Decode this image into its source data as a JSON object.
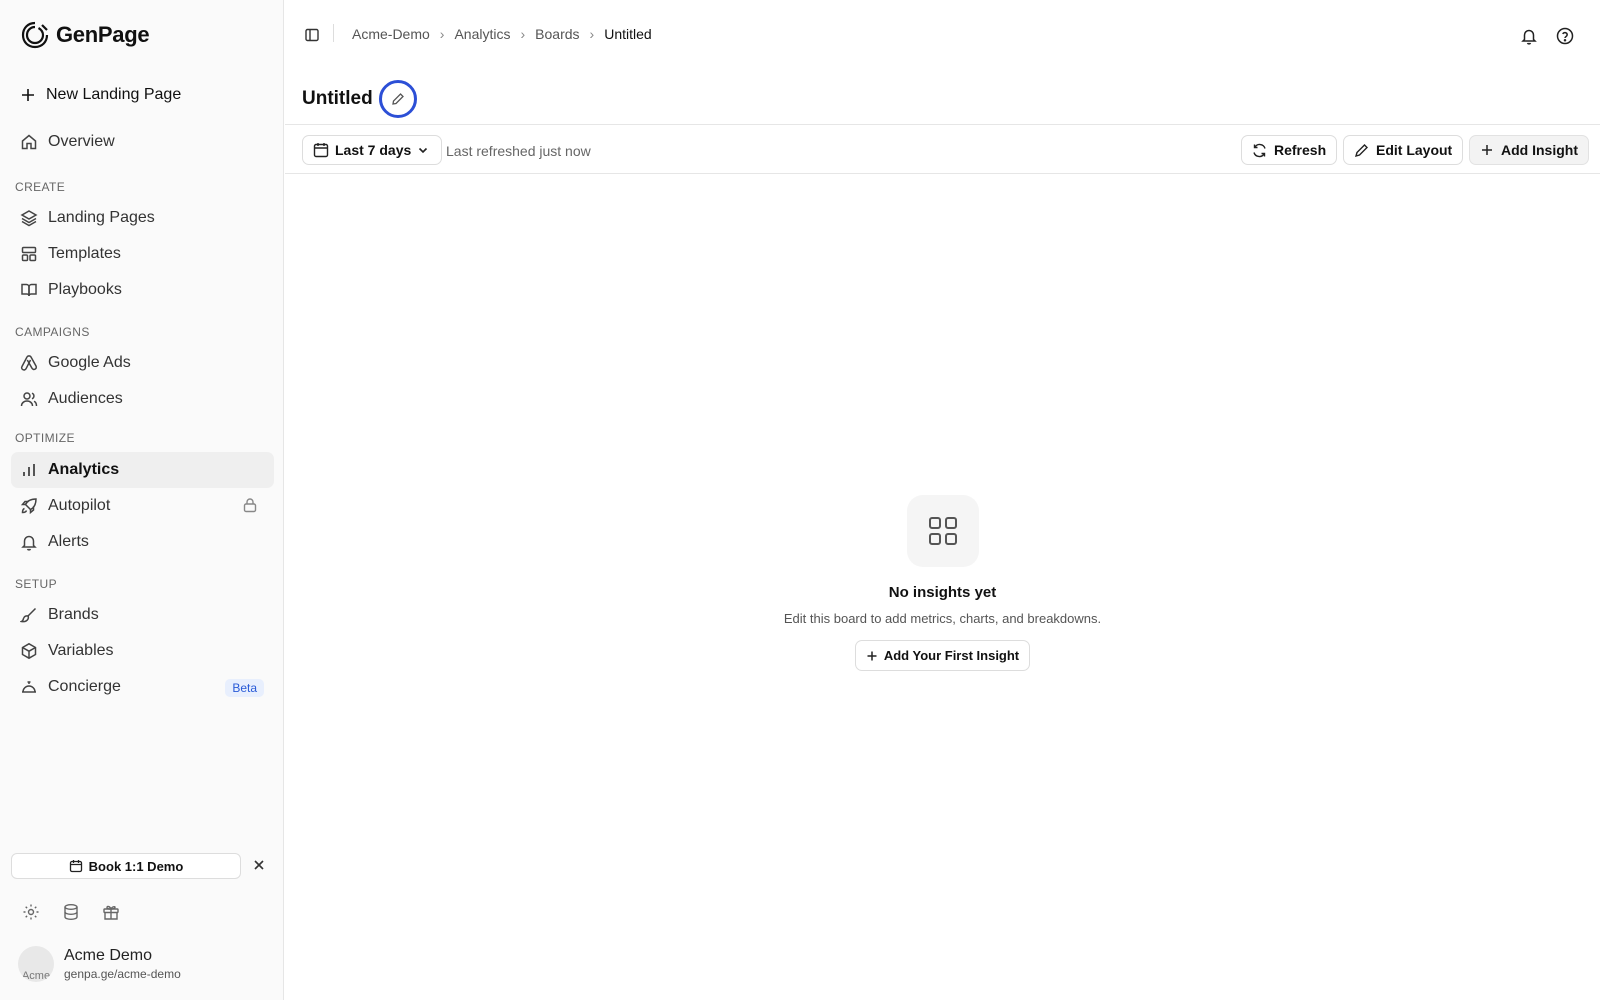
{
  "app": {
    "name": "GenPage"
  },
  "sidebar": {
    "new_page_label": "New Landing Page",
    "overview_label": "Overview",
    "sections": {
      "create": "CREATE",
      "campaigns": "CAMPAIGNS",
      "optimize": "OPTIMIZE",
      "setup": "SETUP"
    },
    "items": {
      "landing_pages": "Landing Pages",
      "templates": "Templates",
      "playbooks": "Playbooks",
      "google_ads": "Google Ads",
      "audiences": "Audiences",
      "analytics": "Analytics",
      "autopilot": "Autopilot",
      "alerts": "Alerts",
      "brands": "Brands",
      "variables": "Variables",
      "concierge": "Concierge"
    },
    "concierge_badge": "Beta",
    "demo_button_label": "Book 1:1 Demo",
    "user": {
      "name": "Acme Demo",
      "url": "genpa.ge/acme-demo",
      "avatar_alt": "Acme"
    }
  },
  "breadcrumb": {
    "items": [
      "Acme-Demo",
      "Analytics",
      "Boards"
    ],
    "current": "Untitled"
  },
  "page": {
    "title": "Untitled"
  },
  "toolbar": {
    "range_label": "Last 7 days",
    "refreshed_text": "Last refreshed just now",
    "refresh_label": "Refresh",
    "edit_layout_label": "Edit Layout",
    "add_insight_label": "Add Insight"
  },
  "empty_state": {
    "title": "No insights yet",
    "subtitle": "Edit this board to add metrics, charts, and breakdowns.",
    "button_label": "Add Your First Insight"
  },
  "colors": {
    "accent_ring": "#2c4fd6",
    "beta_bg": "#e8effd",
    "beta_text": "#2a5bd7"
  }
}
